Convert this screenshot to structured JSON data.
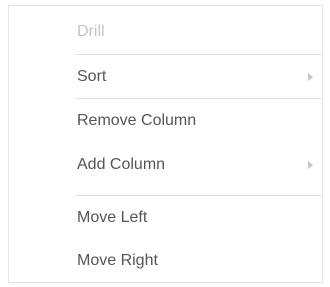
{
  "context_menu": {
    "items": [
      {
        "label": "Drill",
        "disabled": true,
        "submenu": false
      },
      {
        "label": "Sort",
        "disabled": false,
        "submenu": true
      },
      {
        "label": "Remove Column",
        "disabled": false,
        "submenu": false
      },
      {
        "label": "Add Column",
        "disabled": false,
        "submenu": true
      },
      {
        "label": "Move Left",
        "disabled": false,
        "submenu": false
      },
      {
        "label": "Move Right",
        "disabled": false,
        "submenu": false
      }
    ],
    "icons": {
      "submenu_arrow": "chevron-right-icon"
    },
    "colors": {
      "text": "#555555",
      "text_disabled": "#c4c4c4",
      "separator": "#e0e0e0",
      "border": "#e3e3e3",
      "arrow": "#c6c6c6",
      "background": "#ffffff"
    }
  }
}
